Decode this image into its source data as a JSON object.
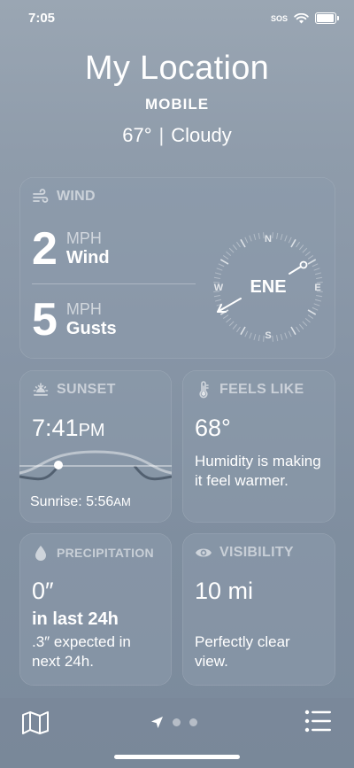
{
  "status_bar": {
    "time": "7:05",
    "sos": "SOS"
  },
  "header": {
    "title": "My Location",
    "subtitle": "MOBILE",
    "temperature": "67°",
    "separator": "|",
    "condition": "Cloudy"
  },
  "wind": {
    "title": "WIND",
    "wind_value": "2",
    "wind_unit": "MPH",
    "wind_label": "Wind",
    "gust_value": "5",
    "gust_unit": "MPH",
    "gust_label": "Gusts",
    "direction": "ENE",
    "compass": {
      "n": "N",
      "e": "E",
      "s": "S",
      "w": "W"
    }
  },
  "sunset": {
    "title": "SUNSET",
    "time": "7:41",
    "time_suffix": "PM",
    "sunrise_label": "Sunrise: 5:56",
    "sunrise_suffix": "AM"
  },
  "feels_like": {
    "title": "FEELS LIKE",
    "value": "68°",
    "description": "Humidity is making it feel warmer."
  },
  "precipitation": {
    "title": "PRECIPITATION",
    "value": "0″",
    "period": "in last 24h",
    "forecast": ".3″ expected in next 24h."
  },
  "visibility": {
    "title": "VISIBILITY",
    "value": "10 mi",
    "description": "Perfectly clear view."
  },
  "icons": {
    "map": "map-icon",
    "location": "location-arrow-icon",
    "list": "list-icon"
  }
}
